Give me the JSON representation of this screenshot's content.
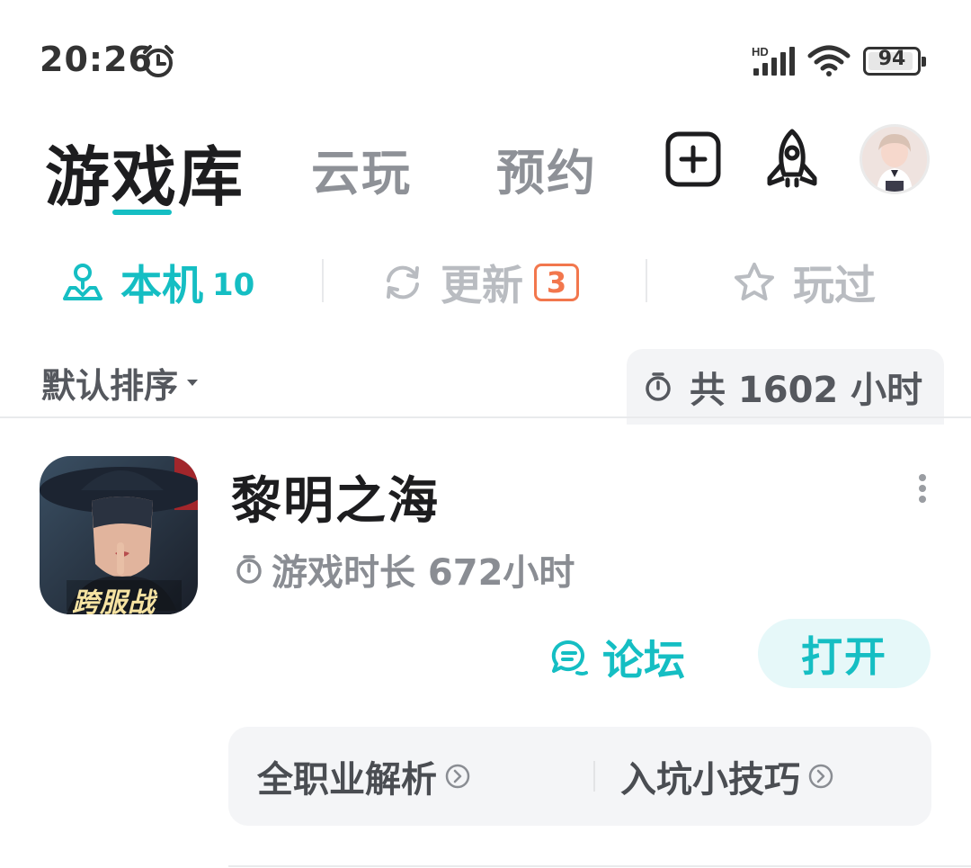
{
  "status_bar": {
    "time": "20:26",
    "network_label": "HD",
    "battery_level": 94,
    "battery_text": "94"
  },
  "header": {
    "tabs": [
      {
        "label": "游戏库",
        "active": true
      },
      {
        "label": "云玩",
        "active": false
      },
      {
        "label": "预约",
        "active": false
      }
    ],
    "icons": [
      "add-icon",
      "rocket-icon",
      "avatar"
    ]
  },
  "sub_tabs": {
    "local": {
      "label": "本机",
      "count": "10",
      "icon": "location-person-icon"
    },
    "update": {
      "label": "更新",
      "badge": "3",
      "icon": "refresh-icon"
    },
    "played": {
      "label": "玩过",
      "icon": "star-icon"
    }
  },
  "sort": {
    "label": "默认排序"
  },
  "total_time": {
    "text": "共 1602 小时",
    "icon": "timer-icon"
  },
  "game": {
    "title": "黎明之海",
    "icon_caption": "跨服战",
    "playtime": "游戏时长 672小时",
    "forum_label": "论坛",
    "open_label": "打开",
    "guides": [
      {
        "label": "全职业解析"
      },
      {
        "label": "入坑小技巧"
      }
    ]
  },
  "colors": {
    "accent": "#15bec3",
    "badge": "#f2774d",
    "muted": "#8e9197"
  }
}
